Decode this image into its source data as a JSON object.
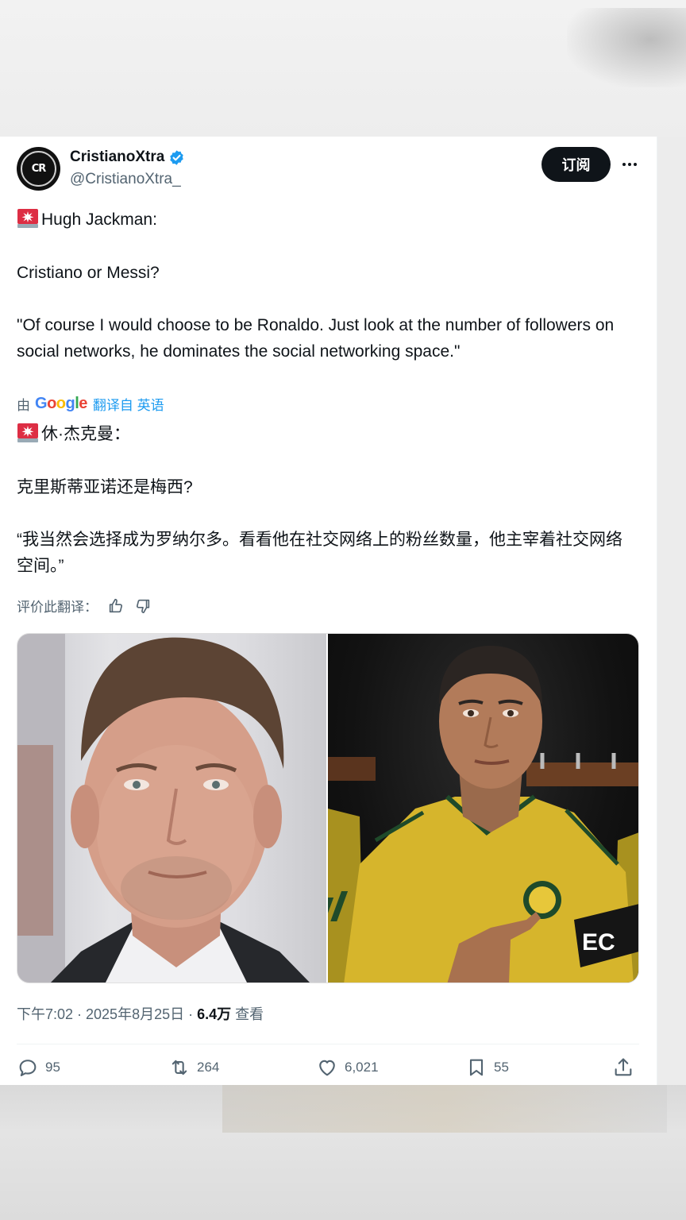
{
  "tweet": {
    "display_name": "CristianoXtra",
    "handle": "@CristianoXtra_",
    "avatar_text": "CR",
    "subscribe_label": "订阅",
    "more_icon": "more-horizontal-icon",
    "original": {
      "line1": "Hugh Jackman:",
      "line2": "Cristiano or Messi?",
      "line3": "\"Of course I would choose to be Ronaldo. Just look at the number of followers on social networks, he dominates the social networking space.\""
    },
    "translation": {
      "by": "由",
      "provider": "Google",
      "link": "翻译自 英语",
      "line1": "休·杰克曼：",
      "line2": "克里斯蒂亚诺还是梅西?",
      "line3": "“我当然会选择成为罗纳尔多。看看他在社交网络上的粉丝数量，他主宰着社交网络空间。”"
    },
    "rate_label": "评价此翻译：",
    "timestamp": "下午7:02 · 2025年8月25日 · ",
    "views_count": "6.4万",
    "views_label": " 查看",
    "actions": {
      "replies": "95",
      "reposts": "264",
      "likes": "6,021",
      "bookmarks": "55"
    },
    "colors": {
      "accent": "#1d9bf0",
      "text": "#0f1419",
      "muted": "#536471",
      "siren": "#e0245e"
    }
  }
}
